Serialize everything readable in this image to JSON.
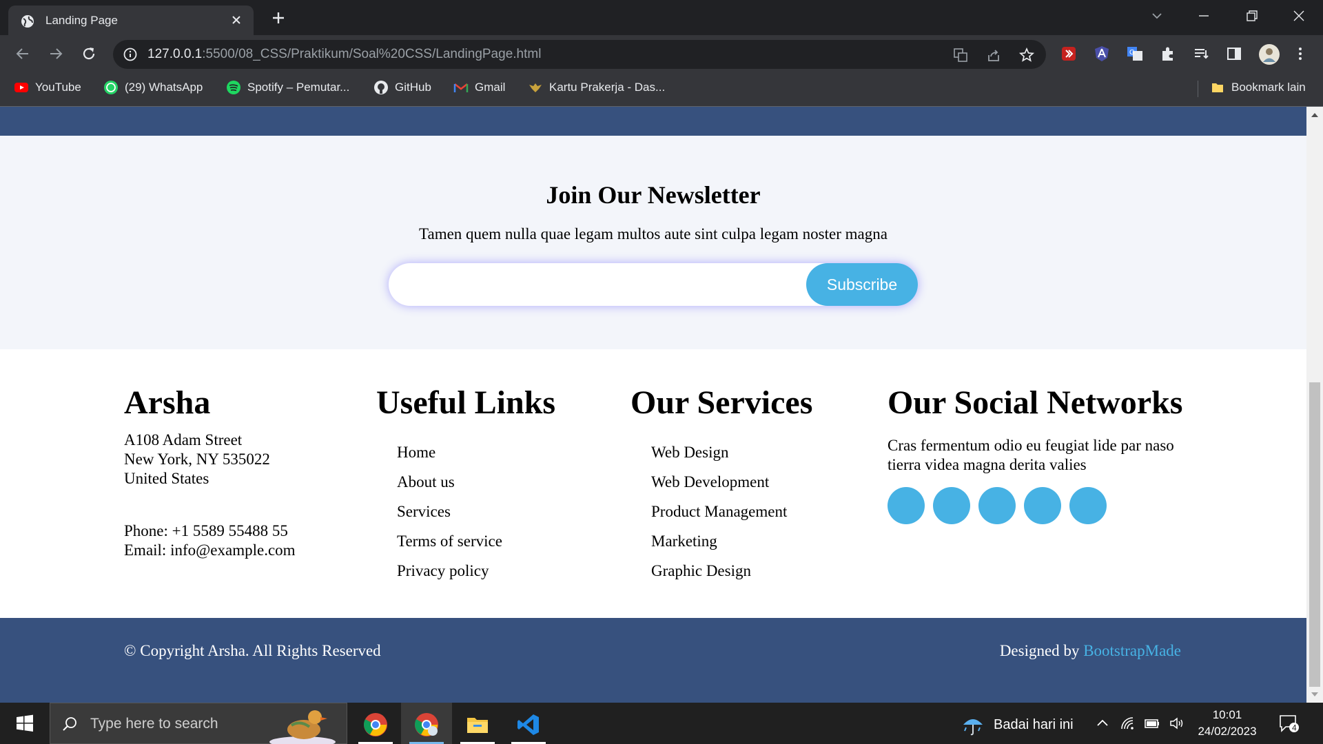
{
  "browser": {
    "tab_title": "Landing Page",
    "url_host": "127.0.0.1",
    "url_path": ":5500/08_CSS/Praktikum/Soal%20CSS/LandingPage.html",
    "bookmarks": [
      {
        "label": "YouTube",
        "icon": "youtube-icon"
      },
      {
        "label": "(29) WhatsApp",
        "icon": "whatsapp-icon"
      },
      {
        "label": "Spotify – Pemutar...",
        "icon": "spotify-icon"
      },
      {
        "label": "GitHub",
        "icon": "github-icon"
      },
      {
        "label": "Gmail",
        "icon": "gmail-icon"
      },
      {
        "label": "Kartu Prakerja - Das...",
        "icon": "garuda-icon"
      }
    ],
    "other_bookmarks": "Bookmark lain"
  },
  "page": {
    "newsletter": {
      "title": "Join Our Newsletter",
      "text": "Tamen quem nulla quae legam multos aute sint culpa legam noster magna",
      "input_value": "",
      "button": "Subscribe"
    },
    "footer": {
      "brand": "Arsha",
      "address": [
        "A108 Adam Street",
        "New York, NY 535022",
        "United States"
      ],
      "phone": "Phone: +1 5589 55488 55",
      "email": "Email: info@example.com",
      "useful_links_title": "Useful Links",
      "useful_links": [
        "Home",
        "About us",
        "Services",
        "Terms of service",
        "Privacy policy"
      ],
      "services_title": "Our Services",
      "services": [
        "Web Design",
        "Web Development",
        "Product Management",
        "Marketing",
        "Graphic Design"
      ],
      "social_title": "Our Social Networks",
      "social_text": "Cras fermentum odio eu feugiat lide par naso tierra videa magna derita valies",
      "social_icon_count": 5,
      "copyright": "© Copyright Arsha. All Rights Reserved",
      "designed_by": "Designed by",
      "designer": "BootstrapMade"
    },
    "colors": {
      "accent": "#47b2e4",
      "navy": "#37517e",
      "light_bg": "#f3f5fa"
    }
  },
  "taskbar": {
    "search_placeholder": "Type here to search",
    "weather": "Badai hari ini",
    "time": "10:01",
    "date": "24/02/2023",
    "notification_count": "4"
  }
}
